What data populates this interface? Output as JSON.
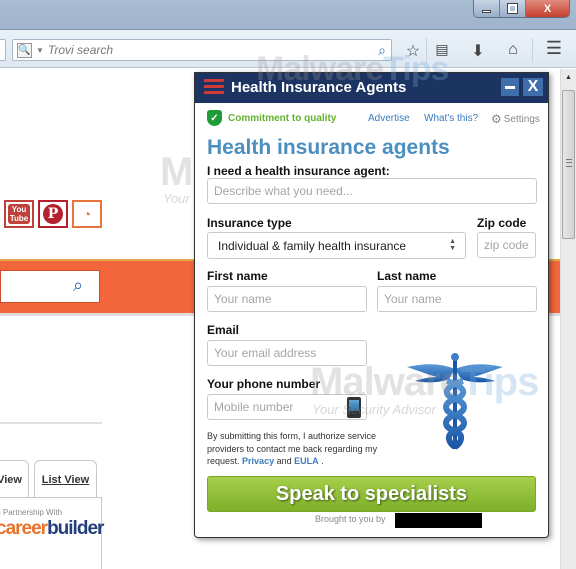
{
  "window": {
    "controls": {
      "minimize": "minimize",
      "restore": "restore",
      "close": "X"
    }
  },
  "toolbar": {
    "search_placeholder": "Trovi search",
    "engine_icon": "magnifier-engine-icon",
    "icons": [
      "bookmark-star-icon",
      "reading-list-icon",
      "download-icon",
      "home-icon",
      "menu-icon"
    ]
  },
  "page": {
    "social": {
      "youtube": "You Tube",
      "pinterest": "P",
      "rss": "rss"
    },
    "tabs": {
      "grid_view": "View",
      "list_view": "List View"
    },
    "partner": {
      "text": "In Partnership With",
      "logo_career": "career",
      "logo_builder": "builder"
    }
  },
  "watermark": {
    "brand_a": "Malware",
    "brand_b": "Tips",
    "tagline": "Your Security Advisor"
  },
  "popup": {
    "title": "Health Insurance Agents",
    "minimize_label": "–",
    "close_label": "X",
    "quality": "Commitment to quality",
    "links": {
      "advertise": "Advertise",
      "whats_this": "What's this?",
      "settings": "Settings"
    },
    "heading": "Health insurance agents",
    "form": {
      "need_label": "I need a health insurance agent:",
      "need_placeholder": "Describe what you need...",
      "insurance_type_label": "Insurance type",
      "insurance_type_value": "Individual & family health insurance",
      "zip_label": "Zip code",
      "zip_placeholder": "zip code",
      "first_name_label": "First name",
      "first_name_placeholder": "Your name",
      "last_name_label": "Last name",
      "last_name_placeholder": "Your name",
      "email_label": "Email",
      "email_placeholder": "Your email address",
      "phone_label": "Your phone number",
      "phone_placeholder": "Mobile number"
    },
    "disclaimer": {
      "text": "By submitting this form, I authorize service providers to contact me back regarding my request.",
      "privacy": "Privacy",
      "and": "and",
      "eula": "EULA",
      "end": "."
    },
    "submit_label": "Speak to specialists",
    "brought_by": "Brought to you by"
  },
  "colors": {
    "header_navy": "#1c3461",
    "heading_blue": "#4b8fc1",
    "link_blue": "#3a7bbd",
    "quality_green": "#62b22f",
    "button_green": "#8dbf36",
    "site_orange": "#f3663c"
  }
}
